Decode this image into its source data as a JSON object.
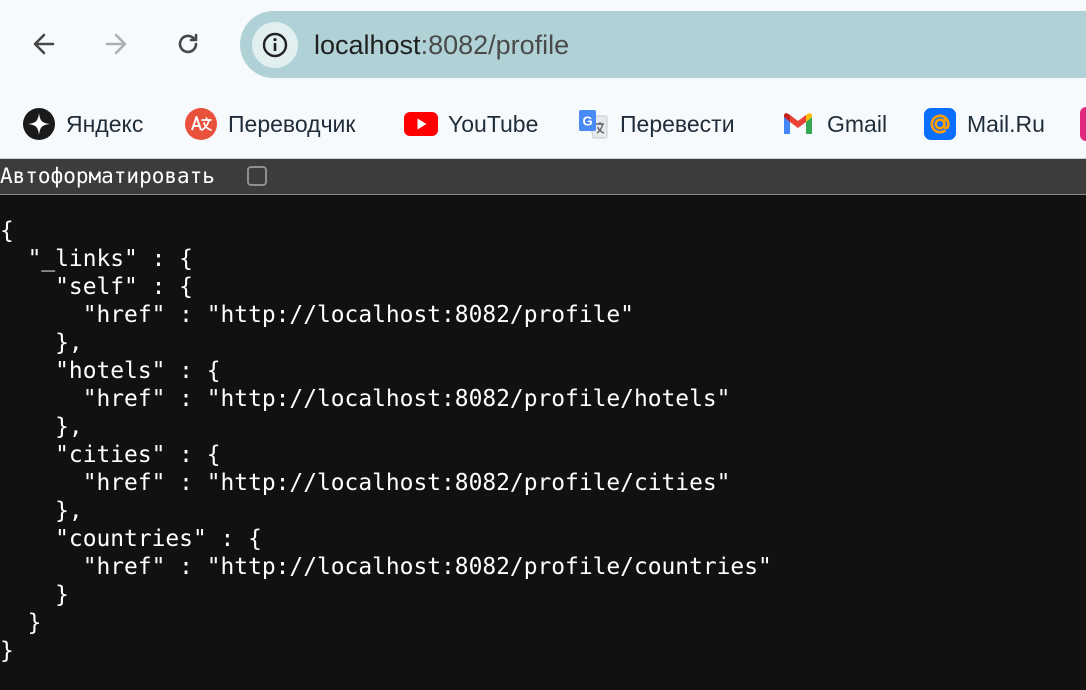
{
  "toolbar": {
    "back": "arrow-left-icon",
    "forward": "arrow-right-icon",
    "reload": "reload-icon",
    "site_info": "info-icon",
    "url_host": "localhost",
    "url_path": ":8082/profile"
  },
  "bookmarks": [
    {
      "label": "Яндекс",
      "icon": "yandex-icon"
    },
    {
      "label": "Переводчик",
      "icon": "translator-icon"
    },
    {
      "label": "YouTube",
      "icon": "youtube-icon"
    },
    {
      "label": "Перевести",
      "icon": "google-translate-icon"
    },
    {
      "label": "Gmail",
      "icon": "gmail-icon"
    },
    {
      "label": "Mail.Ru",
      "icon": "mailru-icon"
    }
  ],
  "autoformat": {
    "label": "Автоформатировать",
    "checked": false
  },
  "json_lines": [
    "{",
    "  \"_links\" : {",
    "    \"self\" : {",
    "      \"href\" : \"http://localhost:8082/profile\"",
    "    },",
    "    \"hotels\" : {",
    "      \"href\" : \"http://localhost:8082/profile/hotels\"",
    "    },",
    "    \"cities\" : {",
    "      \"href\" : \"http://localhost:8082/profile/cities\"",
    "    },",
    "    \"countries\" : {",
    "      \"href\" : \"http://localhost:8082/profile/countries\"",
    "    }",
    "  }",
    "}"
  ],
  "colors": {
    "omnibox": "#b0d2d6",
    "background": "#111111",
    "autobar": "#3c3c3c",
    "youtube": "#ff0000",
    "mailru": "#0a6eff"
  }
}
